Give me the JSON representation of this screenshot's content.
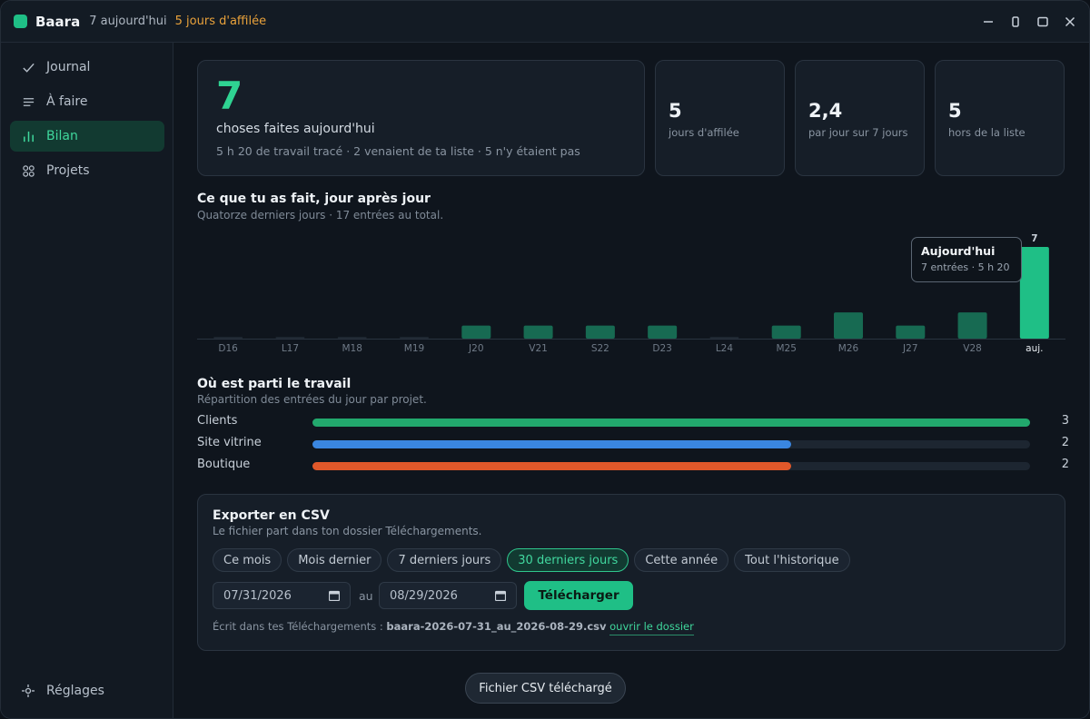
{
  "titlebar": {
    "app_name": "Baara",
    "today": "7 aujourd'hui",
    "streak": "5 jours d'affilée"
  },
  "sidebar": {
    "items": [
      {
        "label": "Journal",
        "icon": "check-icon"
      },
      {
        "label": "À faire",
        "icon": "list-icon"
      },
      {
        "label": "Bilan",
        "icon": "bar-chart-icon",
        "active": true
      },
      {
        "label": "Projets",
        "icon": "grid-icon"
      }
    ],
    "settings_label": "Réglages"
  },
  "summary": {
    "big_value": "7",
    "big_label": "choses faites aujourd'hui",
    "big_sub": "5 h 20 de travail tracé · 2 venaient de ta liste · 5 n'y étaient pas",
    "stats": [
      {
        "value": "5",
        "label": "jours d'affilée"
      },
      {
        "value": "2,4",
        "label": "par jour sur 7 jours"
      },
      {
        "value": "5",
        "label": "hors de la liste"
      }
    ]
  },
  "daily": {
    "title": "Ce que tu as fait, jour après jour",
    "subtitle": "Quatorze derniers jours · 17 entrées au total.",
    "tooltip_title": "Aujourd'hui",
    "tooltip_sub": "7 entrées · 5 h 20"
  },
  "chart_data": {
    "type": "bar",
    "categories": [
      "D16",
      "L17",
      "M18",
      "M19",
      "J20",
      "V21",
      "S22",
      "D23",
      "L24",
      "M25",
      "M26",
      "J27",
      "V28",
      "auj."
    ],
    "values": [
      0,
      0,
      0,
      0,
      1,
      1,
      1,
      1,
      0,
      1,
      2,
      1,
      2,
      7
    ],
    "highlight_index": 13,
    "highlight_label": "7",
    "ylim": [
      0,
      7
    ],
    "colors": {
      "bar": "#176a52",
      "highlight": "#1fbf86",
      "empty": "#1e2731"
    }
  },
  "projects": {
    "title": "Où est parti le travail",
    "subtitle": "Répartition des entrées du jour par projet.",
    "rows": [
      {
        "name": "Clients",
        "count": "3",
        "fraction": 1.0,
        "color": "#22a86d"
      },
      {
        "name": "Site vitrine",
        "count": "2",
        "fraction": 0.667,
        "color": "#3a86e0"
      },
      {
        "name": "Boutique",
        "count": "2",
        "fraction": 0.667,
        "color": "#e0582a"
      }
    ]
  },
  "export": {
    "title": "Exporter en CSV",
    "subtitle": "Le fichier part dans ton dossier Téléchargements.",
    "chips": [
      "Ce mois",
      "Mois dernier",
      "7 derniers jours",
      "30 derniers jours",
      "Cette année",
      "Tout l'historique"
    ],
    "active_chip": 3,
    "from_date": "07/31/2026",
    "to_label": "au",
    "to_date": "08/29/2026",
    "download_label": "Télécharger",
    "note_prefix": "Écrit dans tes Téléchargements :",
    "file_name": "baara-2026-07-31_au_2026-08-29.csv",
    "open_folder": "ouvrir le dossier"
  },
  "toast": "Fichier CSV téléchargé"
}
